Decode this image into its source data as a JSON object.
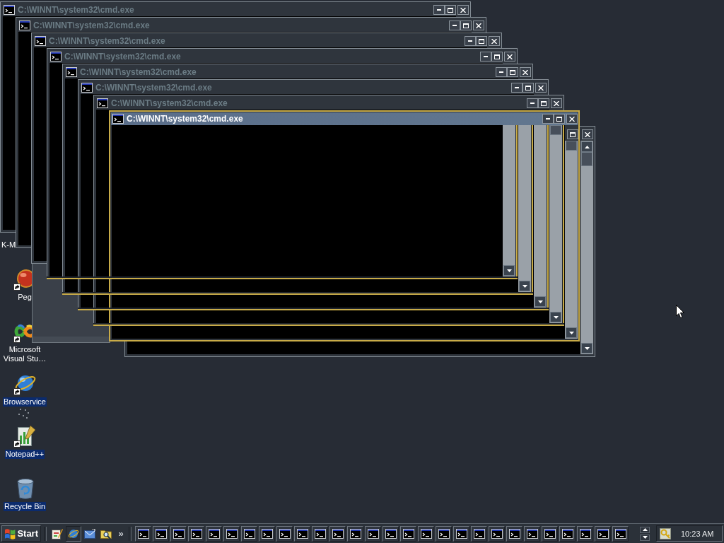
{
  "desktop_icons": [
    {
      "label": "K-M",
      "kind": "label-only",
      "selected": false
    },
    {
      "label": "Peg",
      "kind": "shortcut",
      "selected": false
    },
    {
      "label": "Microsoft Visual Stu…",
      "kind": "shortcut",
      "selected": false
    },
    {
      "label": "Browservice",
      "kind": "shortcut",
      "selected": true
    },
    {
      "label": "Notepad++",
      "kind": "shortcut",
      "selected": true
    },
    {
      "label": "Recycle Bin",
      "kind": "item",
      "selected": true
    }
  ],
  "windows": [
    {
      "title": "C:\\WINNT\\system32\\cmd.exe",
      "active": false
    },
    {
      "title": "C:\\WINNT\\system32\\cmd.exe",
      "active": false
    },
    {
      "title": "C:\\WINNT\\system32\\cmd.exe",
      "active": false
    },
    {
      "title": "C:\\WINNT\\system32\\cmd.exe",
      "active": false
    },
    {
      "title": "C:\\WINNT\\system32\\cmd.exe",
      "active": false
    },
    {
      "title": "C:\\WINNT\\system32\\cmd.exe",
      "active": false
    },
    {
      "title": "C:\\WINNT\\system32\\cmd.exe",
      "active": false
    },
    {
      "title": "C:\\WINNT\\system32\\cmd.exe",
      "active": true
    },
    {
      "active": false
    }
  ],
  "taskbar": {
    "start": "Start",
    "quick_launch": [
      {
        "pressed": false
      },
      {
        "pressed": true
      },
      {
        "pressed": false
      },
      {
        "pressed": false
      }
    ],
    "chevron": "»",
    "task_buttons": [
      {
        "selected": false
      },
      {
        "selected": false
      },
      {
        "selected": false
      },
      {
        "selected": false
      },
      {
        "selected": false
      },
      {
        "selected": false
      },
      {
        "selected": false
      },
      {
        "selected": false
      },
      {
        "selected": false
      },
      {
        "selected": false
      },
      {
        "selected": false
      },
      {
        "selected": false
      },
      {
        "selected": false
      },
      {
        "selected": false
      },
      {
        "selected": false
      },
      {
        "selected": false
      },
      {
        "selected": false
      },
      {
        "selected": false
      },
      {
        "selected": false
      },
      {
        "selected": false
      },
      {
        "selected": false
      },
      {
        "selected": false
      },
      {
        "selected": false
      },
      {
        "selected": false
      },
      {
        "selected": false
      },
      {
        "selected": false
      },
      {
        "selected": false
      },
      {
        "selected": false
      }
    ],
    "clock": "10:23 AM"
  }
}
